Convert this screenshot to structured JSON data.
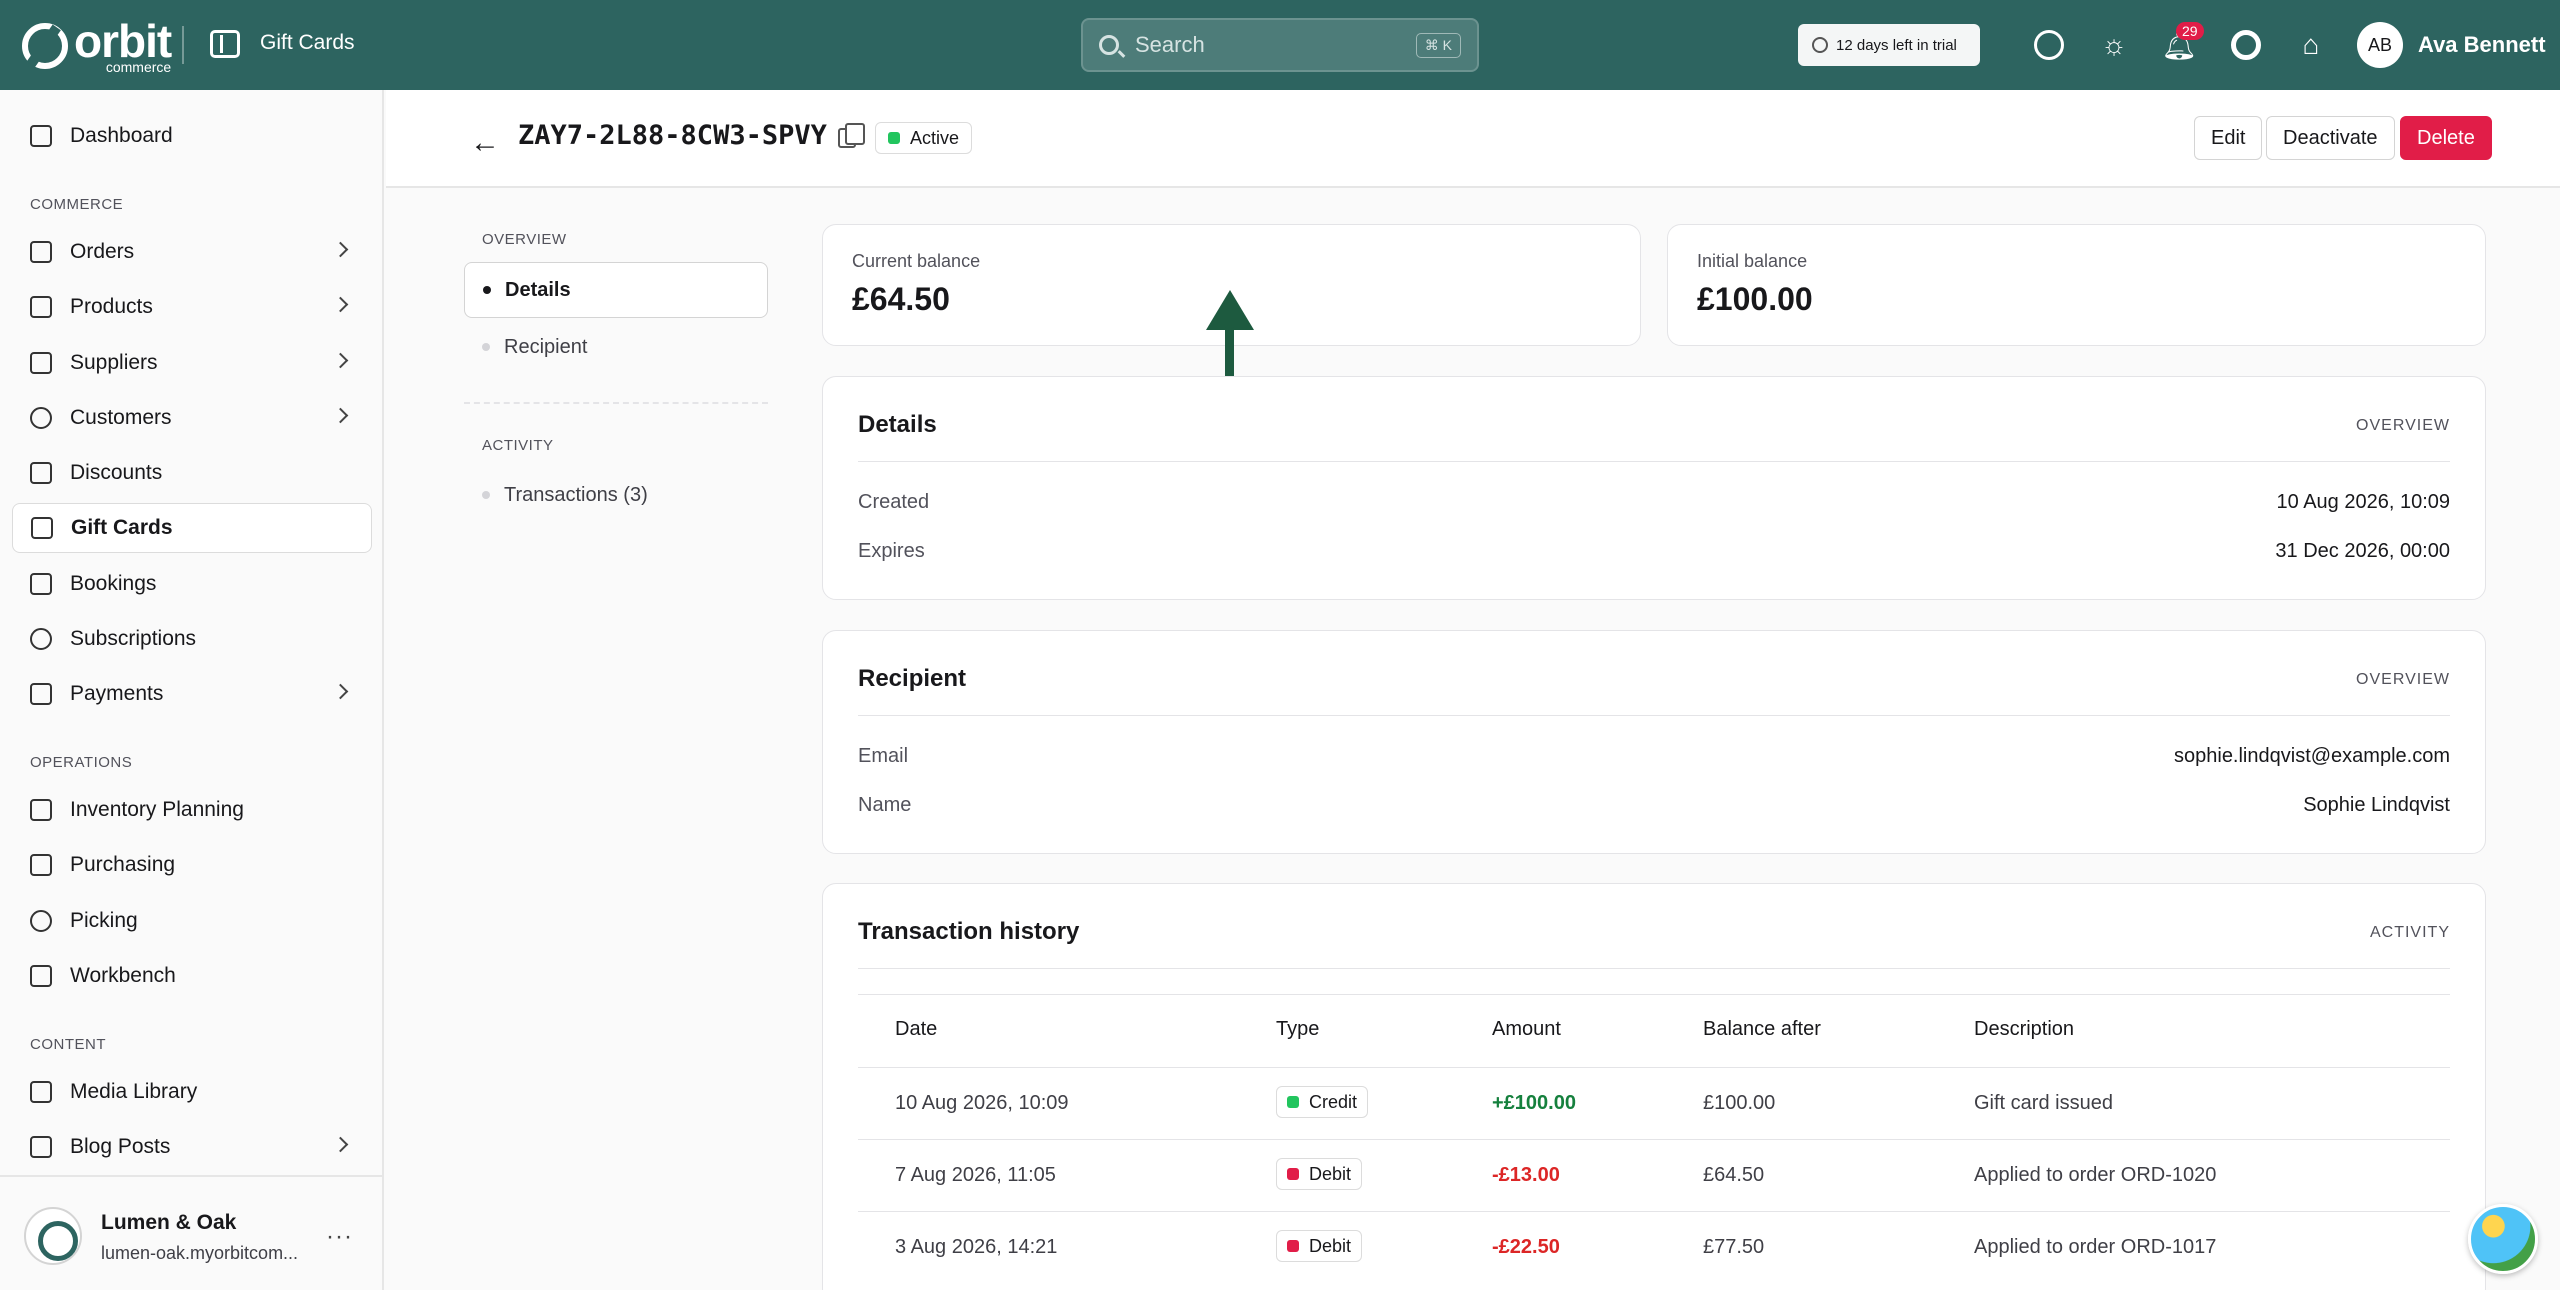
{
  "topbar": {
    "logo_text": "orbit",
    "logo_sub": "commerce",
    "section": "Gift Cards",
    "search_placeholder": "Search",
    "search_shortcut": "⌘ K",
    "trial": "12 days left in trial",
    "notifications_count": "29",
    "avatar_initials": "AB",
    "user_name": "Ava Bennett"
  },
  "sidebar": {
    "dashboard": "Dashboard",
    "section_commerce": "COMMERCE",
    "orders": "Orders",
    "products": "Products",
    "suppliers": "Suppliers",
    "customers": "Customers",
    "discounts": "Discounts",
    "gift_cards": "Gift Cards",
    "bookings": "Bookings",
    "subscriptions": "Subscriptions",
    "payments": "Payments",
    "section_operations": "OPERATIONS",
    "inventory_planning": "Inventory Planning",
    "purchasing": "Purchasing",
    "picking": "Picking",
    "workbench": "Workbench",
    "section_content": "CONTENT",
    "media_library": "Media Library",
    "blog_posts": "Blog Posts",
    "store_name": "Lumen & Oak",
    "store_url": "lumen-oak.myorbitcom...",
    "store_more": "···"
  },
  "header": {
    "back_glyph": "←",
    "code": "ZAY7-2L88-8CW3-SPVY",
    "status": "Active",
    "edit": "Edit",
    "deactivate": "Deactivate",
    "delete": "Delete"
  },
  "section_nav": {
    "overview_label": "OVERVIEW",
    "details": "Details",
    "recipient": "Recipient",
    "activity_label": "ACTIVITY",
    "transactions": "Transactions (3)"
  },
  "balances": {
    "current_label": "Current balance",
    "current_value": "£64.50",
    "initial_label": "Initial balance",
    "initial_value": "£100.00"
  },
  "details": {
    "title": "Details",
    "tag": "OVERVIEW",
    "created_label": "Created",
    "created_value": "10 Aug 2026, 10:09",
    "expires_label": "Expires",
    "expires_value": "31 Dec 2026, 00:00"
  },
  "recipient": {
    "title": "Recipient",
    "tag": "OVERVIEW",
    "email_label": "Email",
    "email_value": "sophie.lindqvist@example.com",
    "name_label": "Name",
    "name_value": "Sophie Lindqvist"
  },
  "transactions": {
    "title": "Transaction history",
    "tag": "ACTIVITY",
    "columns": [
      "Date",
      "Type",
      "Amount",
      "Balance after",
      "Description"
    ],
    "rows": [
      {
        "date": "10 Aug 2026, 10:09",
        "type": "Credit",
        "amount": "+£100.00",
        "balance": "£100.00",
        "description": "Gift card issued"
      },
      {
        "date": "7 Aug 2026, 11:05",
        "type": "Debit",
        "amount": "-£13.00",
        "balance": "£64.50",
        "description": "Applied to order ORD-1020"
      },
      {
        "date": "3 Aug 2026, 14:21",
        "type": "Debit",
        "amount": "-£22.50",
        "balance": "£77.50",
        "description": "Applied to order ORD-1017"
      }
    ]
  },
  "colors": {
    "topbar": "#2d6460",
    "active": "#22c55e",
    "credit": "#22c55e",
    "debit": "#e11d48",
    "danger": "#e11d48",
    "arrow": "#1d5a3f"
  }
}
